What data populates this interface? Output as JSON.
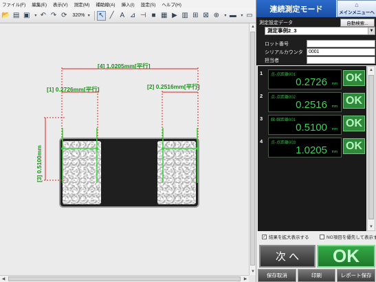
{
  "menu": [
    "ファイル(F)",
    "編集(E)",
    "表示(V)",
    "測定(M)",
    "補助線(A)",
    "挿入(I)",
    "設定(S)",
    "ヘルプ(H)"
  ],
  "toolbar": {
    "zoom": "320%"
  },
  "image": {
    "dims": {
      "d4": "[4] 1.0205mm[平行]",
      "d1": "[1] 0.2726mm[平行]",
      "d2": "[2] 0.2516mm[平行]",
      "d3": "[3] 0.5100mm"
    }
  },
  "panel": {
    "title": "連続測定モード",
    "menu_button": "メインメニューへ",
    "setting_label": "測定設定データ",
    "auto_search": "自動検索...",
    "setting_value": "測定事例2_3",
    "lot_label": "ロット番号",
    "lot_value": "",
    "serial_label": "シリアルカウンタ",
    "serial_value": "0001",
    "person_label": "担当者",
    "person_value": ""
  },
  "results": [
    {
      "num": "1",
      "name": "点-点距離001",
      "value": "0.2726",
      "unit": "mm",
      "status": "OK"
    },
    {
      "num": "2",
      "name": "点-点距離002",
      "value": "0.2516",
      "unit": "mm",
      "status": "OK"
    },
    {
      "num": "3",
      "name": "線-線距離001",
      "value": "0.5100",
      "unit": "mm",
      "status": "OK"
    },
    {
      "num": "4",
      "name": "点-点距離003",
      "value": "1.0205",
      "unit": "mm",
      "status": "OK"
    }
  ],
  "options": {
    "enlarge": "結果を拡大表示する",
    "ng_first": "NG項目を優先して表示する"
  },
  "buttons": {
    "next": "次 へ",
    "ok": "OK",
    "discard": "保存取消",
    "print": "印刷",
    "report": "レポート保存"
  }
}
